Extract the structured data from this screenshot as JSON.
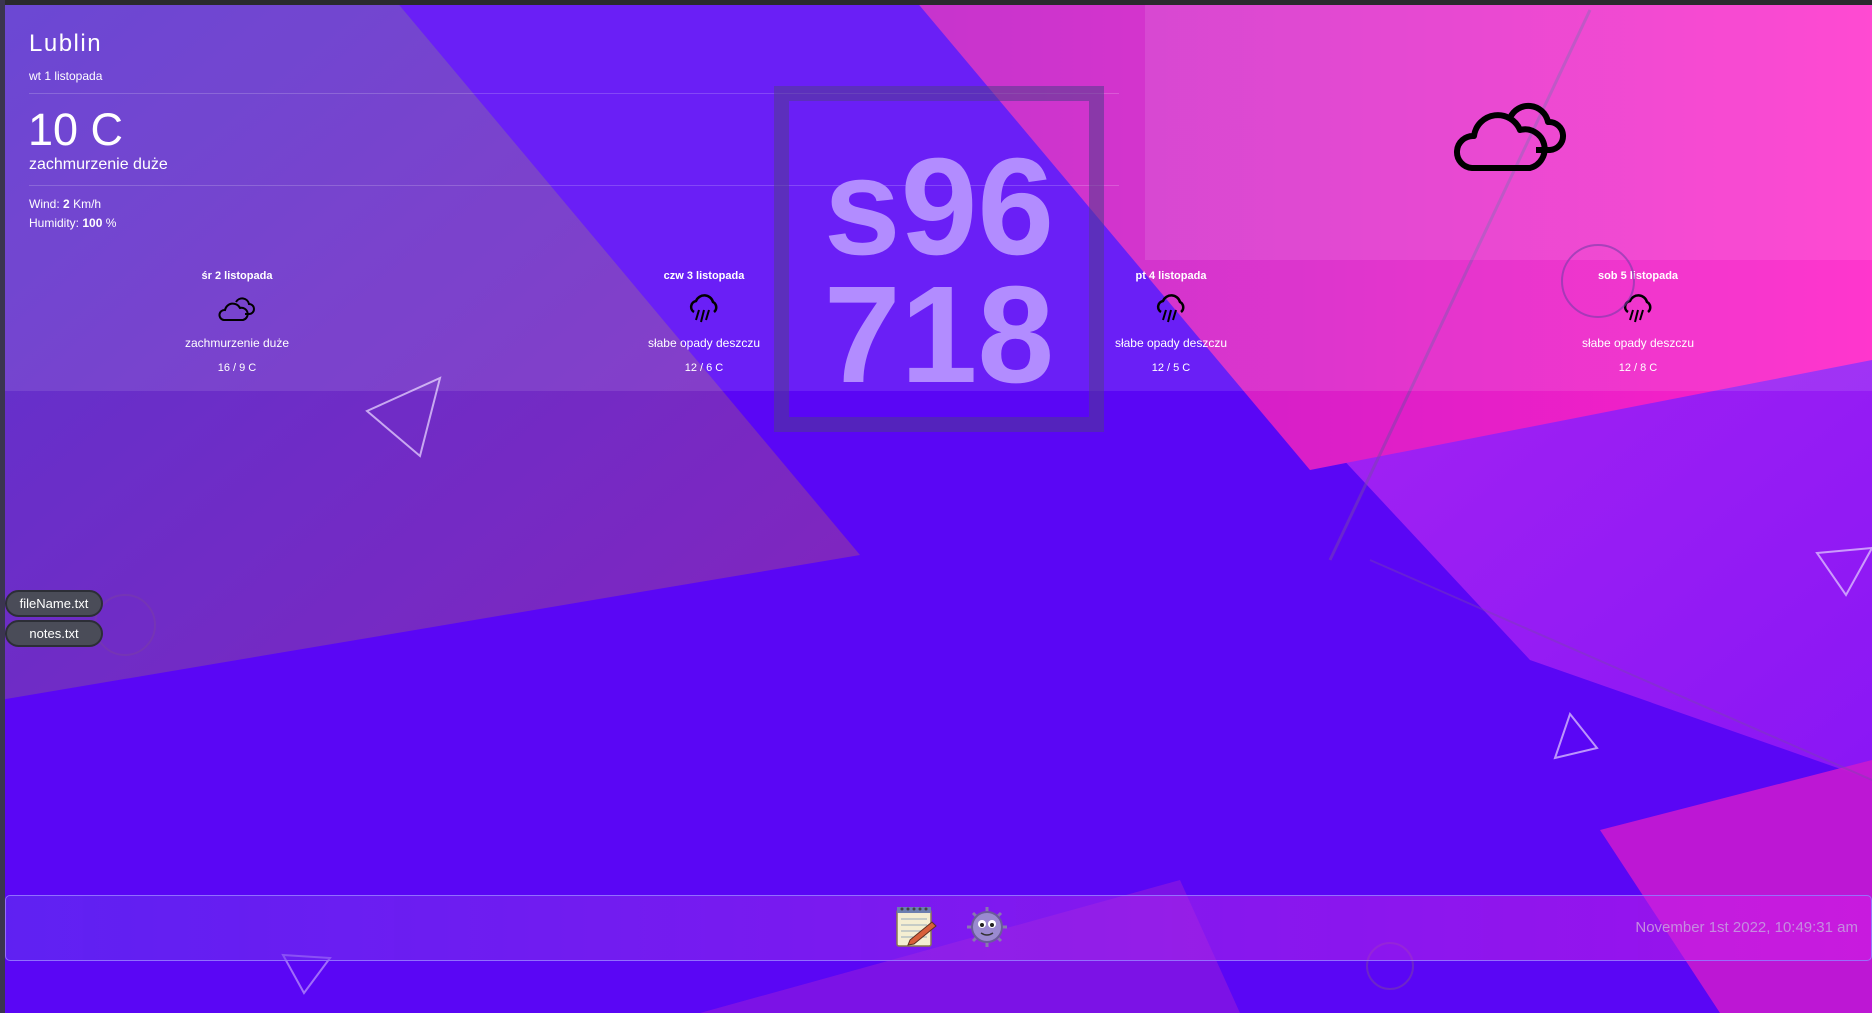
{
  "weather": {
    "city": "Lublin",
    "date": "wt 1 listopada",
    "temperature": "10 C",
    "description": "zachmurzenie duże",
    "wind_label": "Wind:",
    "wind_value": "2",
    "wind_unit": "Km/h",
    "humidity_label": "Humidity:",
    "humidity_value": "100",
    "humidity_unit": "%",
    "current_icon": "clouds-icon",
    "forecast": [
      {
        "day": "śr 2 listopada",
        "icon": "clouds-icon",
        "description": "zachmurzenie duże",
        "temps": "16 / 9 C"
      },
      {
        "day": "czw 3 listopada",
        "icon": "rain-cloud-icon",
        "description": "słabe opady deszczu",
        "temps": "12 / 6 C"
      },
      {
        "day": "pt 4 listopada",
        "icon": "rain-cloud-icon",
        "description": "słabe opady deszczu",
        "temps": "12 / 5 C"
      },
      {
        "day": "sob 5 listopada",
        "icon": "rain-cloud-icon",
        "description": "słabe opady deszczu",
        "temps": "12 / 8 C"
      }
    ]
  },
  "ident": {
    "line1": "s96",
    "line2": "718"
  },
  "desktop": {
    "files": [
      {
        "label": "fileName.txt",
        "icon": "text-file-icon"
      },
      {
        "label": "notes.txt",
        "icon": "text-file-icon"
      }
    ]
  },
  "taskbar": {
    "apps": [
      {
        "name": "notepad",
        "icon": "notepad-icon"
      },
      {
        "name": "virus-app",
        "icon": "virus-icon"
      }
    ],
    "clock": "November 1st 2022, 10:49:31 am"
  },
  "colors": {
    "background": "#5a06f5",
    "accent_pink": "#e81ec8",
    "ident_text": "#b28cff",
    "clock_text": "#c58ce0"
  }
}
